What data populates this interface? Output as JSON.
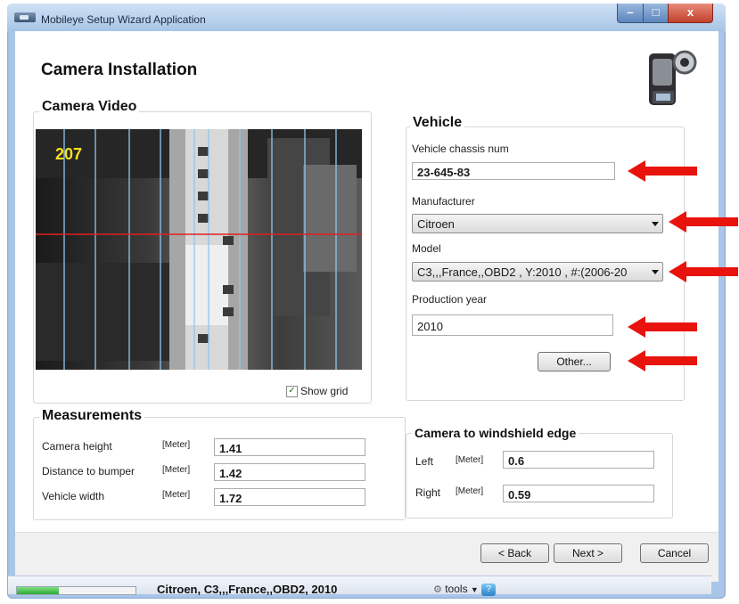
{
  "window": {
    "title": "Mobileye Setup Wizard Application"
  },
  "page": {
    "title": "Camera Installation"
  },
  "camera_video": {
    "title": "Camera Video",
    "frame_number": "207",
    "show_grid_label": "Show grid",
    "show_grid_checked": true,
    "show_grid_check": "✓"
  },
  "vehicle": {
    "title": "Vehicle",
    "chassis_label": "Vehicle chassis  num",
    "chassis_value": "23-645-83",
    "manufacturer_label": "Manufacturer",
    "manufacturer_value": "Citroen",
    "model_label": "Model",
    "model_value": "C3,,,France,,OBD2 , Y:2010 , #:(2006-20",
    "year_label": "Production year",
    "year_value": "2010",
    "other_button": "Other..."
  },
  "measurements": {
    "title": "Measurements",
    "unit": "[Meter]",
    "rows": [
      {
        "label": "Camera height",
        "value": "1.41"
      },
      {
        "label": "Distance to bumper",
        "value": "1.42"
      },
      {
        "label": "Vehicle width",
        "value": "1.72"
      }
    ]
  },
  "windshield": {
    "title": "Camera to windshield edge",
    "left_label": "Left",
    "left_value": "0.6",
    "right_label": "Right",
    "right_value": "0.59"
  },
  "nav": {
    "back": "< Back",
    "next": "Next >",
    "cancel": "Cancel"
  },
  "status": {
    "text": "Citroen, C3,,,France,,OBD2, 2010",
    "tools": "tools",
    "progress": 0.35
  },
  "colors": {
    "annotation_arrow": "#e8130c",
    "video_grid": "#8fc7ee",
    "video_horizon": "#e02020",
    "frame_number": "#f5e020",
    "progress": "#2fa83a"
  },
  "icons": {
    "app": "app-icon",
    "camcorder": "camcorder-icon",
    "dropdown": "chevron-down-icon",
    "tools": "tools-icon",
    "help": "help-icon"
  }
}
